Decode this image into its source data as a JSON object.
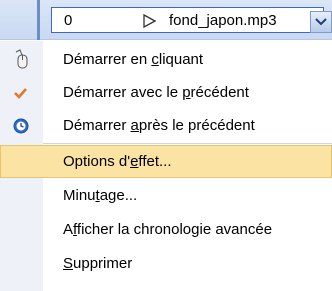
{
  "top_item": {
    "number": "0",
    "file_name": "fond_japon.mp3",
    "play_icon": "play-triangle-icon",
    "dropdown_icon": "chevron-down-icon"
  },
  "menu": {
    "items": [
      {
        "icon": "mouse-click-icon",
        "prefix": "Démarrer en ",
        "accel": "c",
        "suffix": "liquant"
      },
      {
        "icon": "checkmark-icon",
        "prefix": "Démarrer avec le ",
        "accel": "p",
        "suffix": "récédent"
      },
      {
        "icon": "clock-icon",
        "prefix": "Démarrer ",
        "accel": "a",
        "suffix": "près le précédent"
      },
      {
        "prefix": "Options d'",
        "accel": "e",
        "suffix": "ffet..."
      },
      {
        "prefix": "Minu",
        "accel": "t",
        "suffix": "age..."
      },
      {
        "prefix": "A",
        "accel": "f",
        "suffix": "ficher la chronologie avancée"
      },
      {
        "prefix": "",
        "accel": "S",
        "suffix": "upprimer"
      }
    ]
  },
  "colors": {
    "highlight": "#fbe3a3",
    "check": "#e8742c",
    "clock": "#2f6bc4"
  }
}
